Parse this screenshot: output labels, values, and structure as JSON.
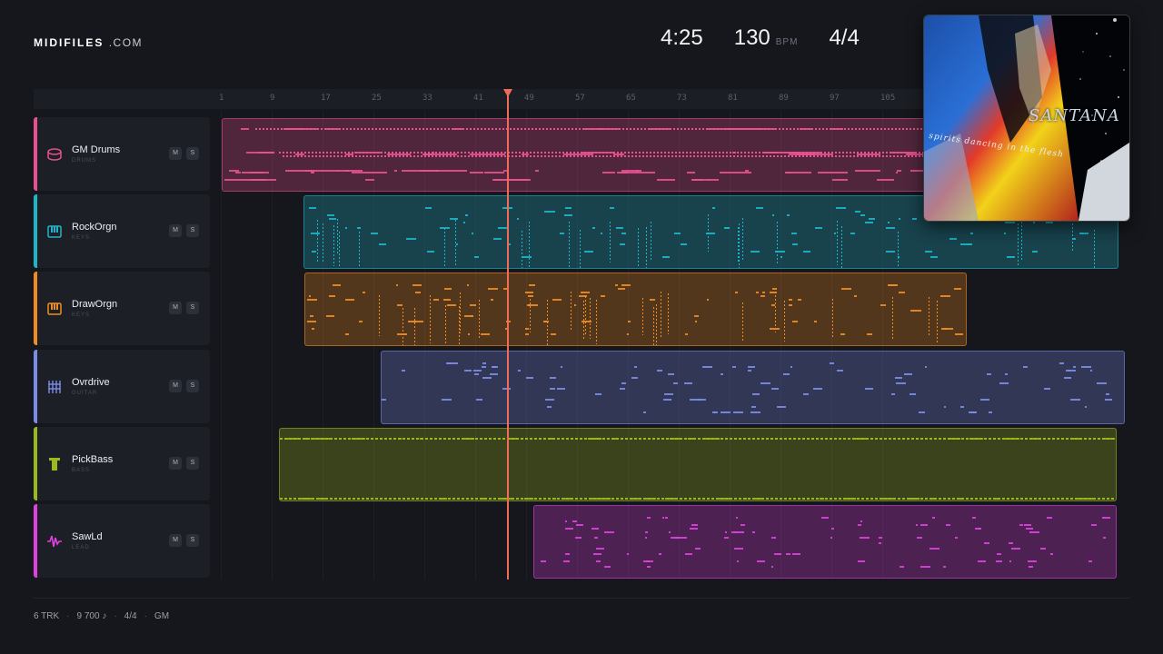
{
  "brand": {
    "name": "MIDIFILES",
    "domain": ".COM"
  },
  "header": {
    "duration": "4:25",
    "tempo": "130",
    "tempo_unit": "BPM",
    "time_signature": "4/4"
  },
  "ruler": {
    "ticks": [
      "1",
      "9",
      "17",
      "25",
      "33",
      "41",
      "49",
      "57",
      "65",
      "73",
      "81",
      "89",
      "97",
      "105"
    ]
  },
  "playback": {
    "position_bar": 49
  },
  "tracks": [
    {
      "name": "GM Drums",
      "type": "DRUMS",
      "color": "#e8508f",
      "icon": "drum-icon",
      "mute": "M",
      "solo": "S"
    },
    {
      "name": "RockOrgn",
      "type": "KEYS",
      "color": "#1fb5c9",
      "icon": "piano-icon",
      "mute": "M",
      "solo": "S"
    },
    {
      "name": "DrawOrgn",
      "type": "KEYS",
      "color": "#f08c22",
      "icon": "piano-icon",
      "mute": "M",
      "solo": "S"
    },
    {
      "name": "Ovrdrive",
      "type": "GUITAR",
      "color": "#7b8de8",
      "icon": "guitar-icon",
      "mute": "M",
      "solo": "S"
    },
    {
      "name": "PickBass",
      "type": "BASS",
      "color": "#9bb81c",
      "icon": "bass-icon",
      "mute": "M",
      "solo": "S"
    },
    {
      "name": "SawLd",
      "type": "LEAD",
      "color": "#e040e0",
      "icon": "wave-icon",
      "mute": "M",
      "solo": "S"
    }
  ],
  "album": {
    "artist_logo": "SANTANA",
    "title": "spirits dancing in the flesh"
  },
  "footer": {
    "tracks": "6 TRK",
    "notes": "9 700 ♪",
    "time_signature": "4/4",
    "format": "GM"
  }
}
